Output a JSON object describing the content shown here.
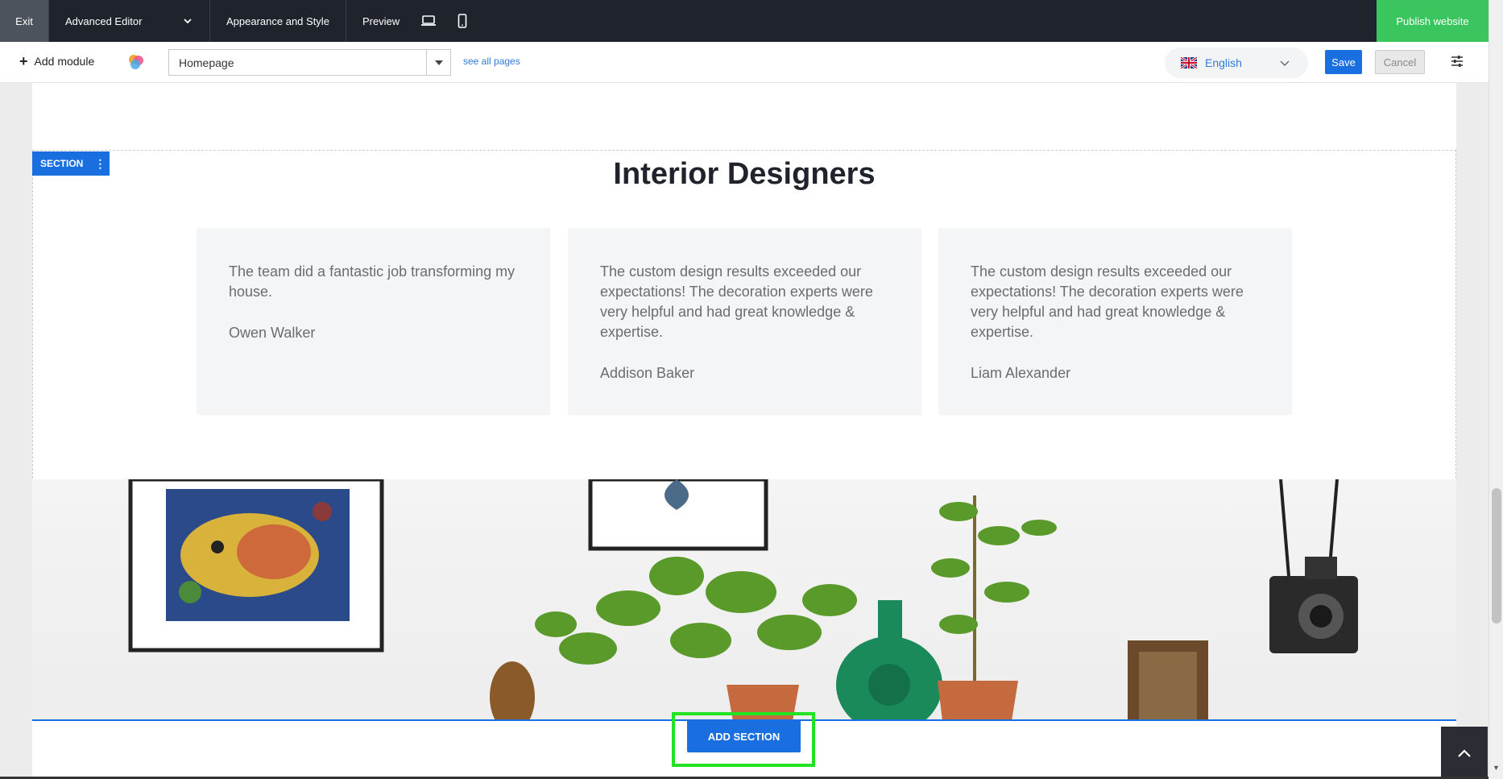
{
  "topbar": {
    "exit": "Exit",
    "advanced_editor": "Advanced Editor",
    "appearance": "Appearance and Style",
    "preview": "Preview",
    "publish": "Publish website"
  },
  "toolbar": {
    "add_module": "Add module",
    "page_selected": "Homepage",
    "see_all_pages": "see all pages",
    "language": "English",
    "save": "Save",
    "cancel": "Cancel"
  },
  "section": {
    "tag": "SECTION",
    "heading": "Interior Designers"
  },
  "testimonials": [
    {
      "text": "The team did a fantastic job transforming my house.",
      "author": "Owen Walker"
    },
    {
      "text": "The custom design results exceeded our expectations! The decoration experts were very helpful and had great knowledge & expertise.",
      "author": "Addison Baker"
    },
    {
      "text": "The custom design results exceeded our expectations! The decoration experts were very helpful and had great knowledge & expertise.",
      "author": "Liam Alexander"
    }
  ],
  "add_section": "ADD SECTION",
  "colors": {
    "accent": "#1a6fe0",
    "publish": "#3ac55e",
    "topbar": "#1f232b",
    "highlight": "#22e323"
  }
}
